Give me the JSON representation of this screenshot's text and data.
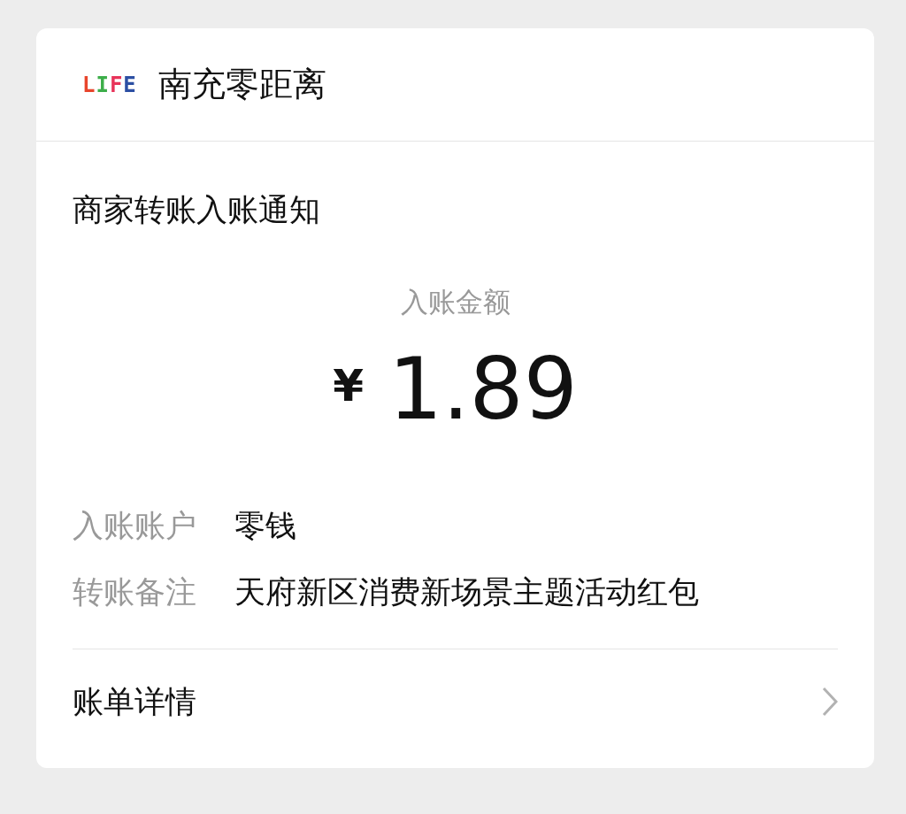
{
  "header": {
    "logo": [
      {
        "letter": "L",
        "color": "#e8452c"
      },
      {
        "letter": "I",
        "color": "#3dae4a"
      },
      {
        "letter": "F",
        "color": "#e8345a"
      },
      {
        "letter": "E",
        "color": "#2c4fa3"
      }
    ],
    "name": "南充零距离"
  },
  "notice": {
    "title": "商家转账入账通知",
    "amount_label": "入账金额",
    "currency": "¥",
    "amount": "1.89"
  },
  "details": [
    {
      "label": "入账账户",
      "value": "零钱"
    },
    {
      "label": "转账备注",
      "value": "天府新区消费新场景主题活动红包"
    }
  ],
  "link": {
    "label": "账单详情"
  }
}
